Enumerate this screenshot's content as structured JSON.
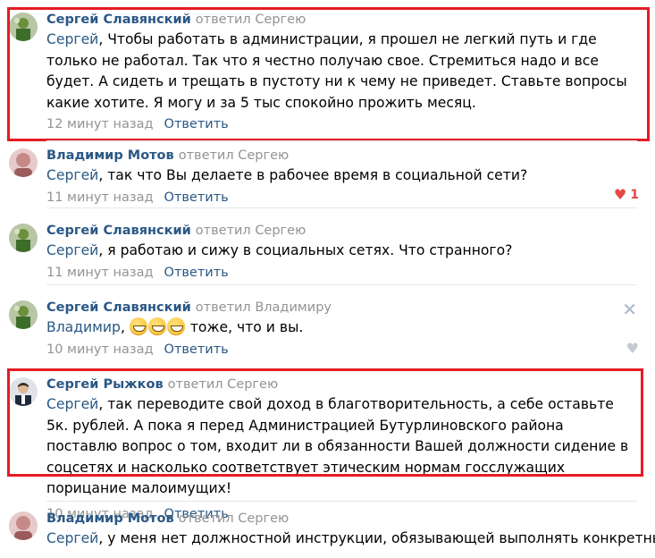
{
  "comments": [
    {
      "author": "Сергей Славянский",
      "verb": "ответил Сергею",
      "addressee": "Сергей",
      "text": ", Чтобы работать в администрации, я прошел не легкий путь и где только не работал. Так что я честно получаю свое. Стремиться надо и все будет. А сидеть и трещать в пустоту ни к чему не приведет. Ставьте вопросы какие хотите. Я могу и за 5 тыс спокойно прожить месяц.",
      "time": "12 минут назад",
      "reply": "Ответить"
    },
    {
      "author": "Владимир Мотов",
      "verb": "ответил Сергею",
      "addressee": "Сергей",
      "text": ", так что Вы делаете в рабочее время в социальной сети?",
      "time": "11 минут назад",
      "reply": "Ответить",
      "likes": "1"
    },
    {
      "author": "Сергей Славянский",
      "verb": "ответил Сергею",
      "addressee": "Сергей",
      "text": ", я работаю и сижу в социальных сетях. Что странного?",
      "time": "11 минут назад",
      "reply": "Ответить"
    },
    {
      "author": "Сергей Славянский",
      "verb": "ответил Владимиру",
      "addressee": "Владимир",
      "text": " тоже, что и вы.",
      "time": "10 минут назад",
      "reply": "Ответить"
    },
    {
      "author": "Сергей Рыжков",
      "verb": "ответил Сергею",
      "addressee": "Сергей",
      "text": ", так переводите свой доход в благотворительность, а себе оставьте 5к. рублей. А пока я перед Администрацией Бутурлиновского района поставлю вопрос о том, входит ли в обязанности Вашей должности сидение в соцсетях и насколько соответствует этическим нормам госслужащих порицание малоимущих!",
      "time": "10 минут назад",
      "reply": "Ответить"
    },
    {
      "author": "Владимир Мотов",
      "verb": "ответил Сергею",
      "addressee": "Сергей",
      "text": ", у меня нет должностной инструкции, обязывающей выполнять конкретные"
    }
  ],
  "icons": {
    "like": "heart-icon",
    "close": "close-icon",
    "emoji": "grinning-emoji-icon"
  },
  "colors": {
    "link": "#2a5885",
    "muted": "#939393",
    "highlight_box": "#e41c24",
    "like_active": "#e64646"
  }
}
